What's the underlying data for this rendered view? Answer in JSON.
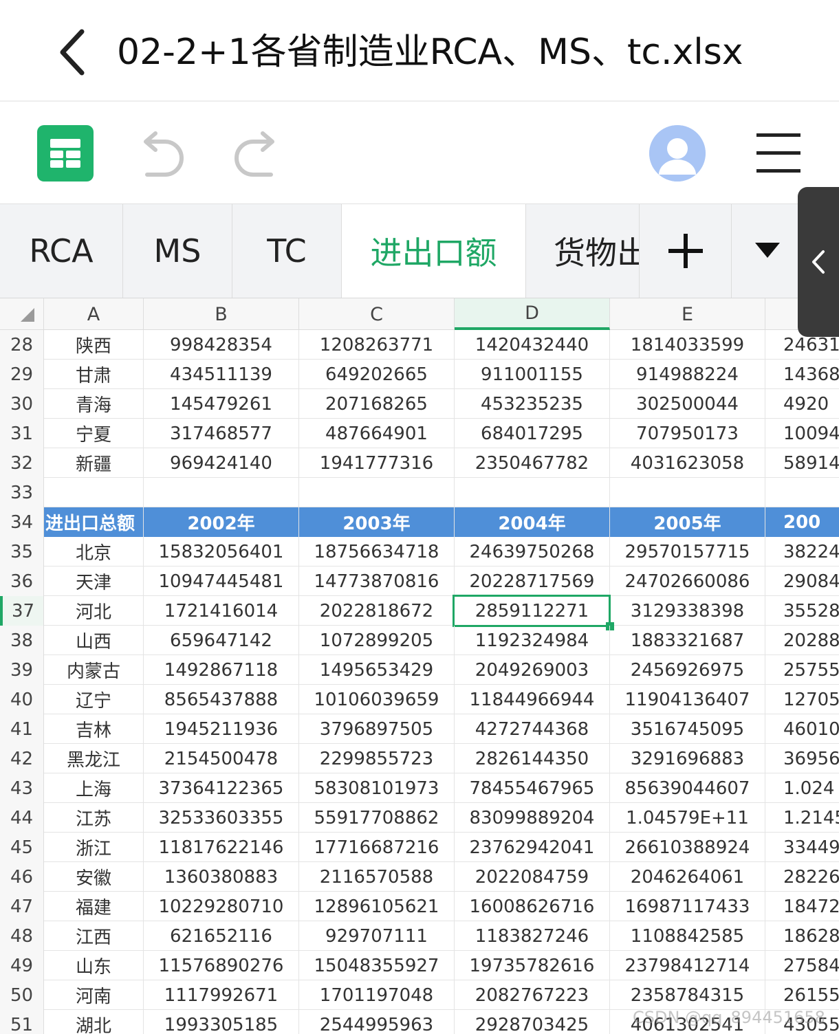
{
  "title": "02-2+1各省制造业RCA、MS、tc.xlsx",
  "icons": {
    "back": "chevron-left-icon",
    "app": "spreadsheet-app-icon",
    "undo": "undo-icon",
    "redo": "redo-icon",
    "avatar": "user-avatar-icon",
    "menu": "hamburger-menu-icon",
    "add_sheet": "plus-icon",
    "sheet_list": "caret-down-icon",
    "side_panel": "chevron-left-icon"
  },
  "colors": {
    "accent": "#1fa765",
    "header_fill": "#4f8fd8",
    "app_icon": "#1fb46c"
  },
  "sheet_tabs": [
    {
      "label": "RCA",
      "active": false
    },
    {
      "label": "MS",
      "active": false
    },
    {
      "label": "TC",
      "active": false
    },
    {
      "label": "进出口额",
      "active": true
    },
    {
      "label": "货物出",
      "active": false
    }
  ],
  "columns": [
    "A",
    "B",
    "C",
    "D",
    "E"
  ],
  "selected": {
    "column": "D",
    "row": "37",
    "value": "2859112271"
  },
  "rows": [
    {
      "n": "28",
      "cells": [
        "陕西",
        "998428354",
        "1208263771",
        "1420432440",
        "1814033599",
        "24631"
      ]
    },
    {
      "n": "29",
      "cells": [
        "甘肃",
        "434511139",
        "649202665",
        "911001155",
        "914988224",
        "14368"
      ]
    },
    {
      "n": "30",
      "cells": [
        "青海",
        "145479261",
        "207168265",
        "453235235",
        "302500044",
        "4920"
      ]
    },
    {
      "n": "31",
      "cells": [
        "宁夏",
        "317468577",
        "487664901",
        "684017295",
        "707950173",
        "10094"
      ]
    },
    {
      "n": "32",
      "cells": [
        "新疆",
        "969424140",
        "1941777316",
        "2350467782",
        "4031623058",
        "58914"
      ]
    },
    {
      "n": "33",
      "cells": [
        "",
        "",
        "",
        "",
        "",
        ""
      ]
    },
    {
      "n": "34",
      "header": true,
      "cells": [
        "进出口总额（",
        "2002年",
        "2003年",
        "2004年",
        "2005年",
        "200"
      ]
    },
    {
      "n": "35",
      "cells": [
        "北京",
        "15832056401",
        "18756634718",
        "24639750268",
        "29570157715",
        "38224"
      ]
    },
    {
      "n": "36",
      "cells": [
        "天津",
        "10947445481",
        "14773870816",
        "20228717569",
        "24702660086",
        "29084"
      ]
    },
    {
      "n": "37",
      "cells": [
        "河北",
        "1721416014",
        "2022818672",
        "2859112271",
        "3129338398",
        "35528"
      ]
    },
    {
      "n": "38",
      "cells": [
        "山西",
        "659647142",
        "1072899205",
        "1192324984",
        "1883321687",
        "20288"
      ]
    },
    {
      "n": "39",
      "cells": [
        "内蒙古",
        "1492867118",
        "1495653429",
        "2049269003",
        "2456926975",
        "25755"
      ]
    },
    {
      "n": "40",
      "cells": [
        "辽宁",
        "8565437888",
        "10106039659",
        "11844966944",
        "11904136407",
        "12705"
      ]
    },
    {
      "n": "41",
      "cells": [
        "吉林",
        "1945211936",
        "3796897505",
        "4272744368",
        "3516745095",
        "46010"
      ]
    },
    {
      "n": "42",
      "cells": [
        "黑龙江",
        "2154500478",
        "2299855723",
        "2826144350",
        "3291696883",
        "36956"
      ]
    },
    {
      "n": "43",
      "cells": [
        "上海",
        "37364122365",
        "58308101973",
        "78455467965",
        "85639044607",
        "1.024"
      ]
    },
    {
      "n": "44",
      "cells": [
        "江苏",
        "32533603355",
        "55917708862",
        "83099889204",
        "1.04579E+11",
        "1.2145"
      ]
    },
    {
      "n": "45",
      "cells": [
        "浙江",
        "11817622146",
        "17716687216",
        "23762942041",
        "26610388924",
        "33449"
      ]
    },
    {
      "n": "46",
      "cells": [
        "安徽",
        "1360380883",
        "2116570588",
        "2022084759",
        "2046264061",
        "28226"
      ]
    },
    {
      "n": "47",
      "cells": [
        "福建",
        "10229280710",
        "12896105621",
        "16008626716",
        "16987117433",
        "18472"
      ]
    },
    {
      "n": "48",
      "cells": [
        "江西",
        "621652116",
        "929707111",
        "1183827246",
        "1108842585",
        "18628"
      ]
    },
    {
      "n": "49",
      "cells": [
        "山东",
        "11576890276",
        "15048355927",
        "19735782616",
        "23798412714",
        "27584"
      ]
    },
    {
      "n": "50",
      "cells": [
        "河南",
        "1117992671",
        "1701197048",
        "2082767223",
        "2358784315",
        "26155"
      ]
    },
    {
      "n": "51",
      "cells": [
        "湖北",
        "1993305185",
        "2544995963",
        "2928703425",
        "4061302541",
        "43055"
      ]
    }
  ],
  "watermark": "CSDN @qq_894451658"
}
